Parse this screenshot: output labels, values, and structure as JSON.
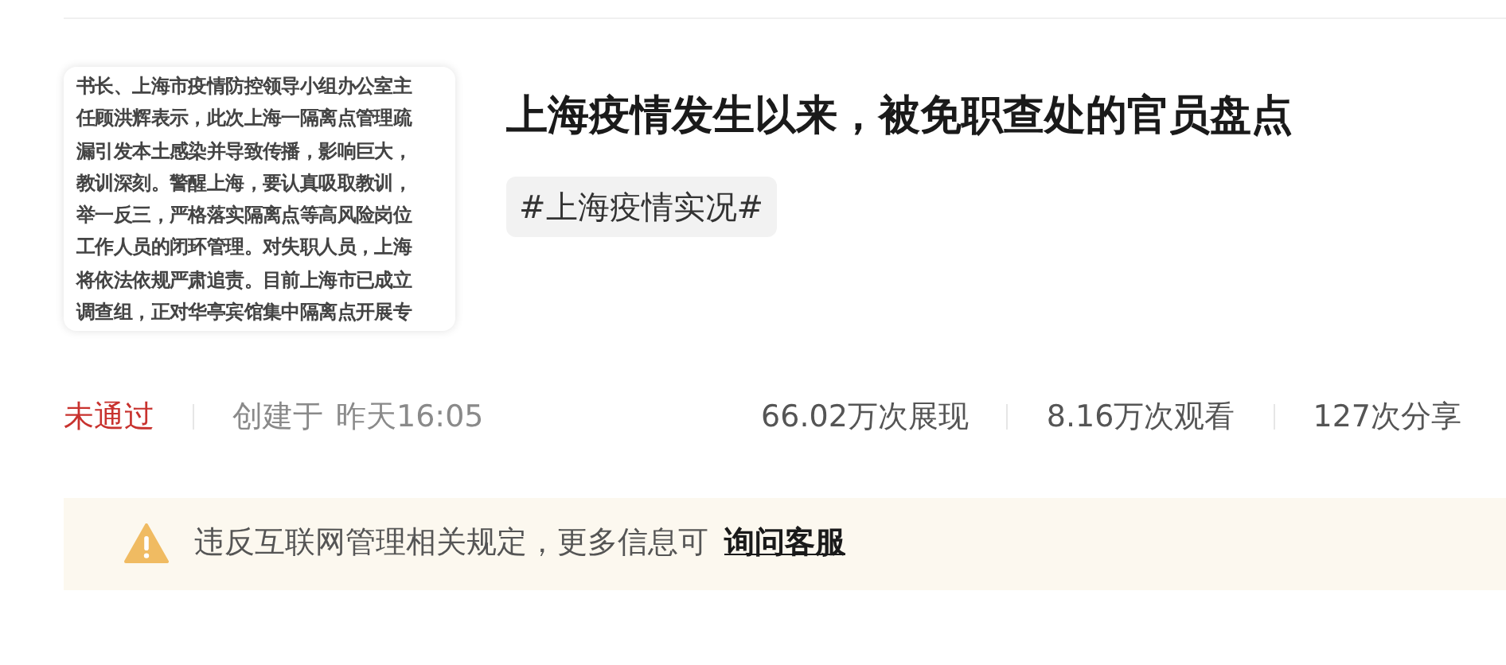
{
  "post": {
    "thumbnail_lines": [
      "书长、上海市疫情防控领导小组办公室主",
      "任顾洪辉表示，此次上海一隔离点管理疏",
      "漏引发本土感染并导致传播，影响巨大，",
      "教训深刻。警醒上海，要认真吸取教训，",
      "举一反三，严格落实隔离点等高风险岗位",
      "工作人员的闭环管理。对失职人员，上海",
      "将依法依规严肃追责。目前上海市已成立",
      "调查组，正对华亭宾馆集中隔离点开展专"
    ],
    "title": "上海疫情发生以来，被免职查处的官员盘点",
    "tag": "#上海疫情实况#"
  },
  "meta": {
    "status": "未通过",
    "passed": false,
    "created_label": "创建于",
    "created_time": "昨天16:05",
    "stats": [
      "66.02万次展现",
      "8.16万次观看",
      "127次分享"
    ]
  },
  "notice": {
    "text": "违反互联网管理相关规定，更多信息可",
    "link": "询问客服"
  }
}
